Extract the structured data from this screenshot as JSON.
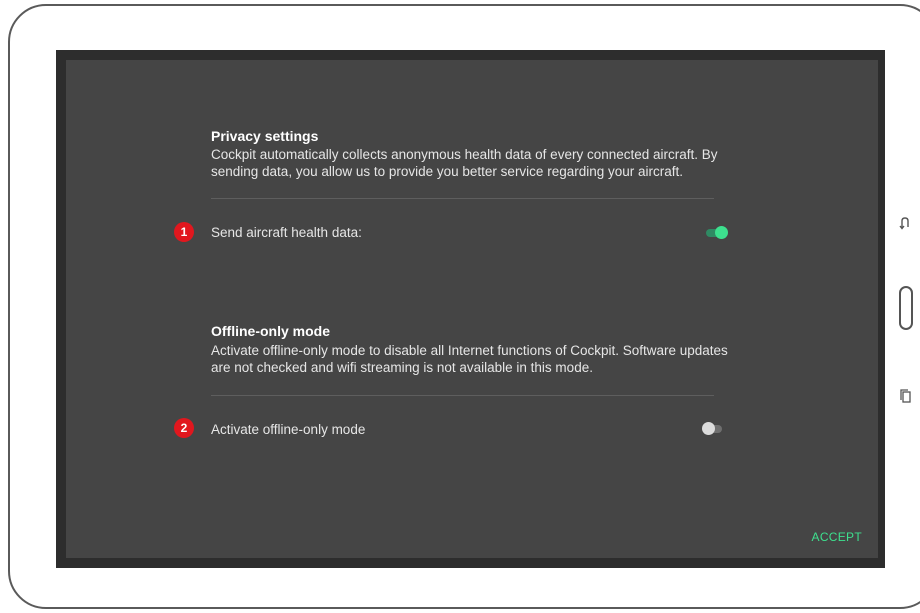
{
  "privacy": {
    "title": "Privacy settings",
    "description": "Cockpit automatically collects anonymous health data of every connected aircraft. By sending data, you allow us to provide you better service regarding your aircraft.",
    "row_label": "Send aircraft health data:",
    "row_badge": "1",
    "toggle_on": true
  },
  "offline": {
    "title": "Offline-only mode",
    "description": "Activate offline-only mode to disable all Internet functions of Cockpit. Software updates are not checked and wifi streaming is not available in this mode.",
    "row_label": "Activate offline-only mode",
    "row_badge": "2",
    "toggle_on": false
  },
  "accept_label": "ACCEPT",
  "colors": {
    "accent": "#3de08e",
    "badge": "#e1171e",
    "dialog_bg": "#454545"
  },
  "device_buttons": {
    "back": "back-icon",
    "home": "home-button",
    "recents": "recents-icon"
  }
}
